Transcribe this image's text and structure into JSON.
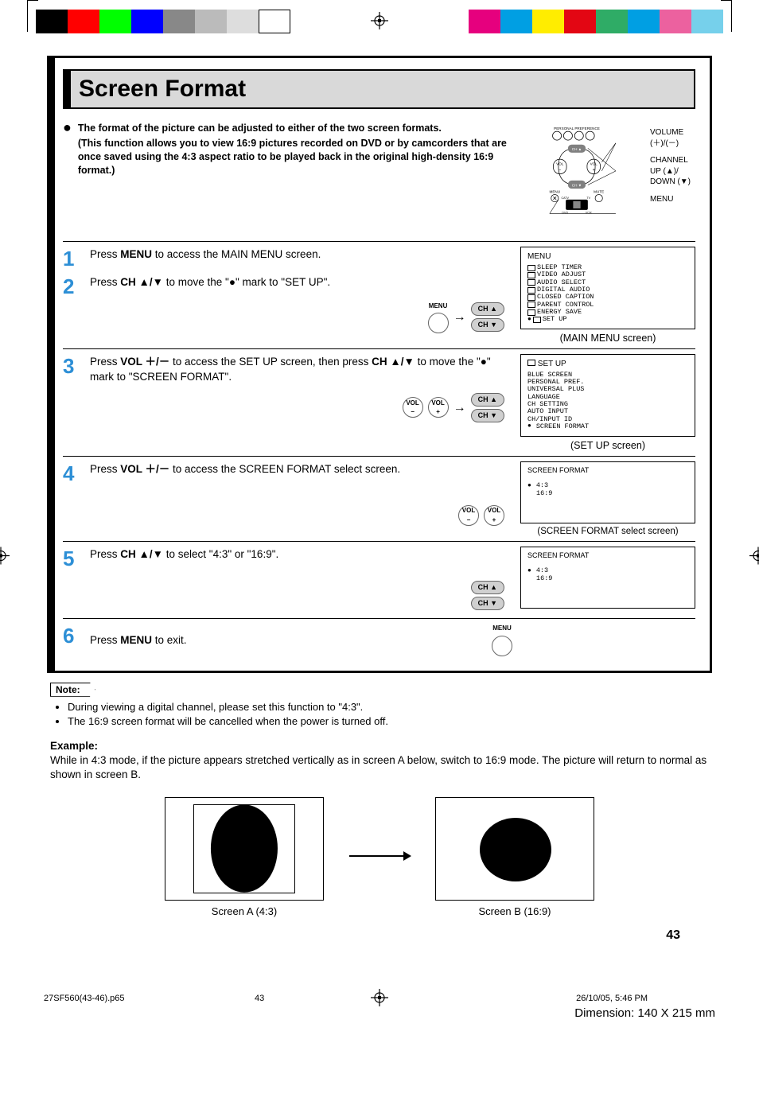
{
  "title": "Screen Format",
  "intro": {
    "line1": "The format of the picture can be adjusted to either of the two screen formats.",
    "line2": "(This function allows you to view 16:9 pictures recorded on DVD or by camcorders that are once saved using the 4:3 aspect ratio to be played back in the original high-density 16:9 format.)"
  },
  "remote_tip": {
    "pp": "PERSONAL PREFERENCE",
    "volume": "VOLUME",
    "volsign": "(＋)/(－)",
    "channel": "CHANNEL",
    "up": "UP (▲)/",
    "down": "DOWN (▼)",
    "menu": "MENU",
    "ch_up": "CH ▲",
    "ch_dn": "CH ▼",
    "vol_m": "VOL −",
    "vol_p": "VOL +",
    "mute": "MUTE",
    "menu_b": "MENU",
    "catv": "CATV",
    "dvd": "DVD",
    "tv": "TV",
    "vcr": "VCR"
  },
  "steps": {
    "s1": {
      "num": "1",
      "text_a": "Press ",
      "bold_a": "MENU",
      "text_b": " to access the MAIN MENU screen."
    },
    "s2": {
      "num": "2",
      "text_a": "Press ",
      "bold_a": "CH ▲/▼",
      "text_b": " to move the \"●\" mark to \"SET UP\"."
    },
    "s3": {
      "num": "3",
      "text_a": "Press ",
      "bold_a": "VOL ＋/－",
      "text_b": " to access the SET UP screen, then press ",
      "bold_b": "CH ▲/▼",
      "text_c": " to move the \"●\" mark to \"SCREEN FORMAT\"."
    },
    "s4": {
      "num": "4",
      "text_a": "Press ",
      "bold_a": "VOL ＋/－",
      "text_b": " to access the SCREEN FORMAT select screen."
    },
    "s5": {
      "num": "5",
      "text_a": "Press ",
      "bold_a": "CH ▲/▼",
      "text_b": " to select \"4:3\" or \"16:9\"."
    },
    "s6": {
      "num": "6",
      "text_a": "Press ",
      "bold_a": "MENU",
      "text_b": " to exit."
    }
  },
  "buttons": {
    "menu": "MENU",
    "ch_up": "CH ▲",
    "ch_dn": "CH ▼",
    "vol_m": "VOL\n−",
    "vol_p": "VOL\n+"
  },
  "screens": {
    "main_menu": {
      "title": "MENU",
      "items": [
        "SLEEP TIMER",
        "VIDEO ADJUST",
        "AUDIO SELECT",
        "DIGITAL AUDIO",
        "CLOSED CAPTION",
        "PARENT CONTROL",
        "ENERGY SAVE",
        "SET UP"
      ],
      "caption": "(MAIN MENU screen)"
    },
    "setup": {
      "title": "SET UP",
      "items": [
        "BLUE SCREEN",
        "PERSONAL PREF.",
        "UNIVERSAL PLUS",
        "LANGUAGE",
        "CH SETTING",
        "AUTO INPUT",
        "CH/INPUT ID",
        "SCREEN FORMAT"
      ],
      "caption": "(SET UP screen)"
    },
    "sf_select": {
      "title": "SCREEN FORMAT",
      "items": [
        "4:3",
        "16:9"
      ],
      "caption": "(SCREEN FORMAT select screen)"
    },
    "sf_select2": {
      "title": "SCREEN FORMAT",
      "items": [
        "4:3",
        "16:9"
      ]
    }
  },
  "note": {
    "label": "Note:",
    "n1": "During viewing a digital channel, please set this function to \"4:3\".",
    "n2": "The 16:9 screen format will be cancelled when the power is turned off."
  },
  "example": {
    "header": "Example:",
    "body": "While in 4:3 mode, if the picture appears stretched vertically as in screen A below, switch to 16:9 mode. The picture will return to normal as shown in screen B.",
    "capA": "Screen A (4:3)",
    "capB": "Screen B (16:9)"
  },
  "footer": {
    "page": "43",
    "file": "27SF560(43-46).p65",
    "pn": "43",
    "date": "26/10/05, 5:46 PM",
    "dim": "Dimension: 140  X 215 mm"
  }
}
